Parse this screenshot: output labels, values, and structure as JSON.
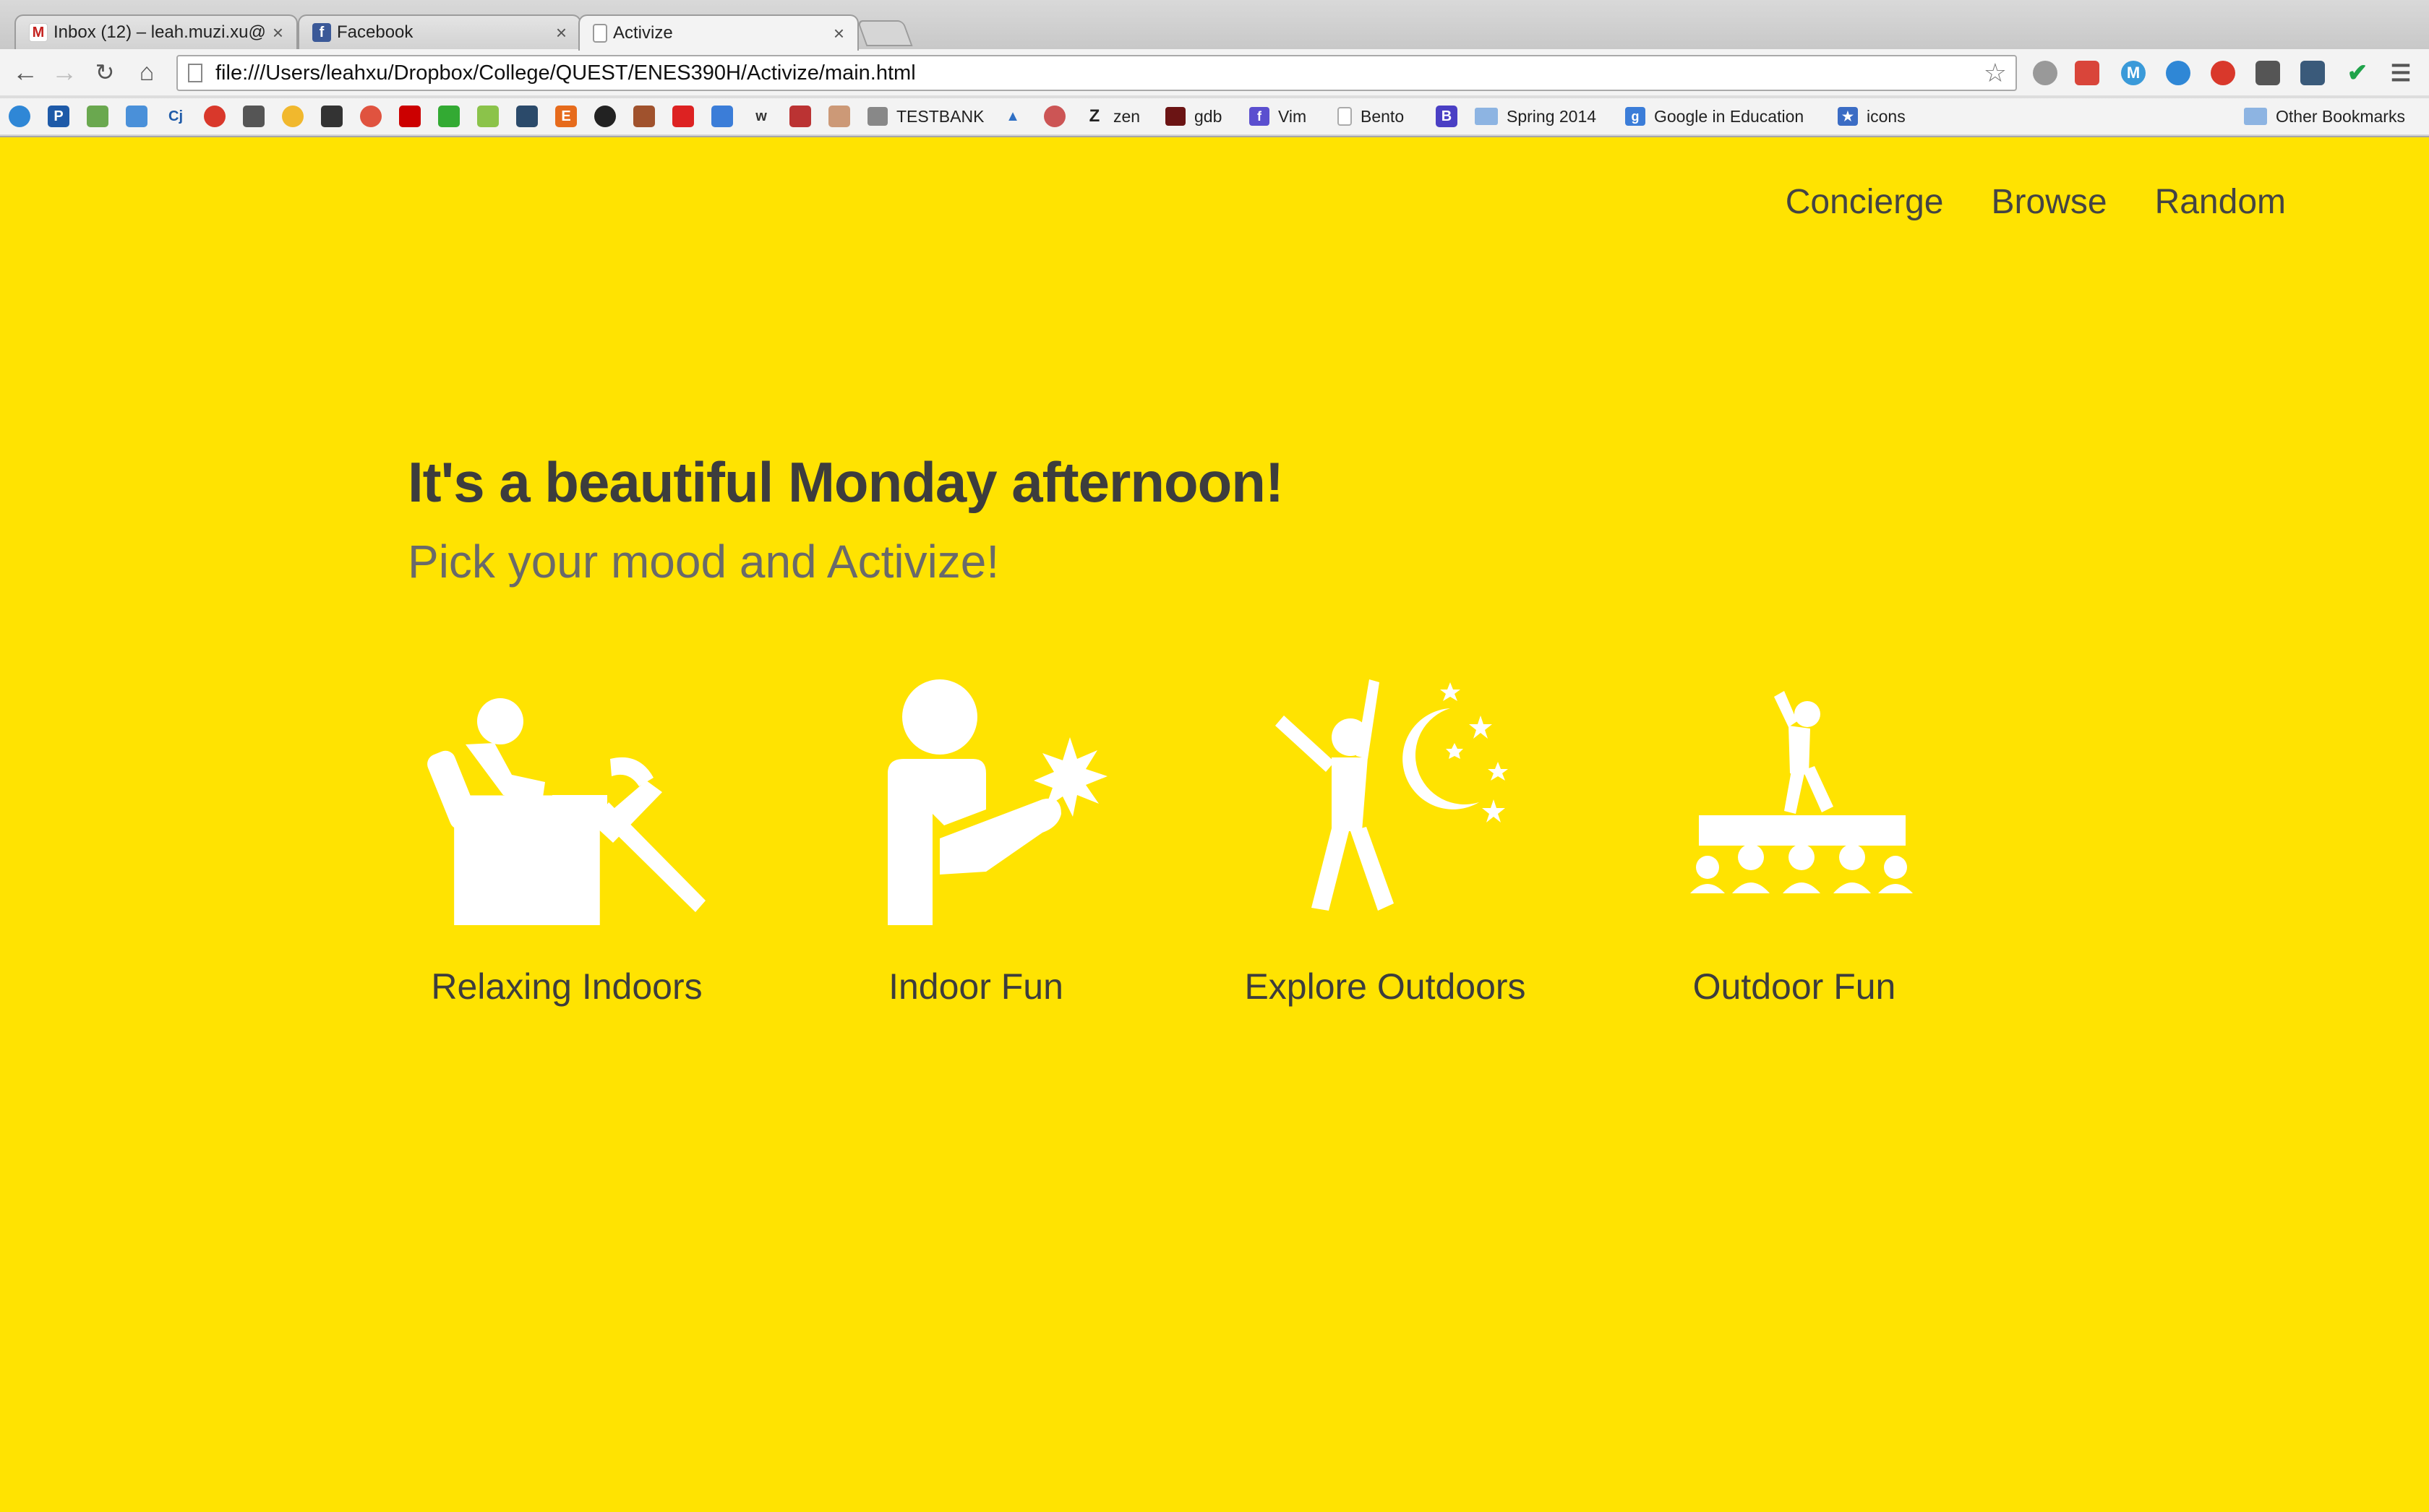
{
  "browser": {
    "tabs": [
      {
        "label": "Inbox (12) – leah.muzi.xu@",
        "favicon": "gmail-icon",
        "badge": "12",
        "close": "×"
      },
      {
        "label": "Facebook",
        "favicon": "facebook-icon",
        "close": "×"
      },
      {
        "label": "Activize",
        "favicon": "page-icon",
        "close": "×"
      }
    ],
    "url": "file:///Users/leahxu/Dropbox/College/QUEST/ENES390H/Activize/main.html",
    "bookmarks": [
      {
        "label": "TESTBANK"
      },
      {
        "label": "zen"
      },
      {
        "label": "gdb"
      },
      {
        "label": "Vim"
      },
      {
        "label": "Bento"
      },
      {
        "label": "Spring 2014"
      },
      {
        "label": "Google in Education"
      },
      {
        "label": "icons"
      }
    ],
    "other_bookmarks": "Other Bookmarks"
  },
  "nav": {
    "items": [
      "Concierge",
      "Browse",
      "Random"
    ]
  },
  "hero": {
    "title": "It's a beautiful Monday afternoon!",
    "subtitle": "Pick your mood and Activize!"
  },
  "moods": [
    {
      "label": "Relaxing Indoors",
      "icon": "recliner-person-icon"
    },
    {
      "label": "Indoor Fun",
      "icon": "person-with-burst-icon"
    },
    {
      "label": "Explore Outdoors",
      "icon": "dancing-moon-stars-icon"
    },
    {
      "label": "Outdoor Fun",
      "icon": "singer-on-stage-icon"
    }
  ],
  "colors": {
    "background": "#FFE301",
    "heading": "#3d3d3d",
    "subheading": "#6a6a6a",
    "icons": "#ffffff"
  }
}
